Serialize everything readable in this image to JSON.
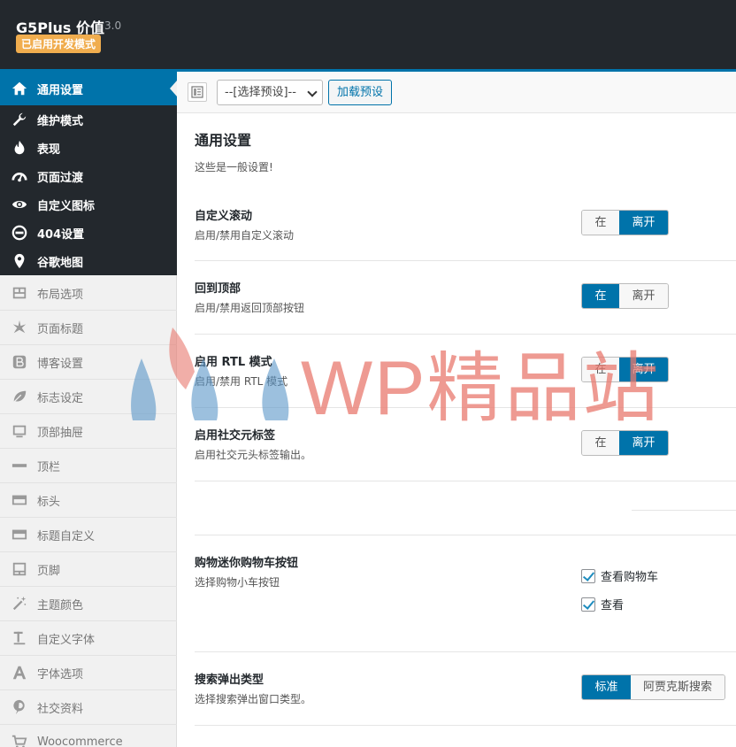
{
  "header": {
    "brand": "G5Plus 价值",
    "version": "3.0",
    "badge": "已启用开发模式"
  },
  "sidebar": {
    "active": {
      "label": "通用设置",
      "icon": "home-icon"
    },
    "dark_items": [
      {
        "label": "维护模式",
        "icon": "wrench-icon"
      },
      {
        "label": "表现",
        "icon": "fire-icon"
      },
      {
        "label": "页面过渡",
        "icon": "speedometer-icon"
      },
      {
        "label": "自定义图标",
        "icon": "eye-icon"
      },
      {
        "label": "404设置",
        "icon": "minus-circle-icon"
      },
      {
        "label": "谷歌地图",
        "icon": "map-pin-icon"
      }
    ],
    "light_items": [
      {
        "label": "布局选项",
        "icon": "layout-icon"
      },
      {
        "label": "页面标题",
        "icon": "star-icon"
      },
      {
        "label": "博客设置",
        "icon": "blog-b-icon"
      },
      {
        "label": "标志设定",
        "icon": "leaf-icon"
      },
      {
        "label": "顶部抽屉",
        "icon": "monitor-icon"
      },
      {
        "label": "顶栏",
        "icon": "dash-icon"
      },
      {
        "label": "标头",
        "icon": "header-icon"
      },
      {
        "label": "标题自定义",
        "icon": "header-custom-icon"
      },
      {
        "label": "页脚",
        "icon": "footer-icon"
      },
      {
        "label": "主题颜色",
        "icon": "magic-wand-icon"
      },
      {
        "label": "自定义字体",
        "icon": "text-t-icon"
      },
      {
        "label": "字体选项",
        "icon": "font-a-icon"
      },
      {
        "label": "社交资料",
        "icon": "pinterest-icon"
      },
      {
        "label": "Woocommerce",
        "icon": "cart-icon"
      }
    ]
  },
  "toolbar": {
    "preset_select": "--[选择预设]--",
    "load_button": "加载预设"
  },
  "main": {
    "title": "通用设置",
    "description": "这些是一般设置!",
    "on_label": "在",
    "off_label": "离开",
    "settings": [
      {
        "title": "自定义滚动",
        "subtitle": "启用/禁用自定义滚动",
        "value": "off"
      },
      {
        "title": "回到顶部",
        "subtitle": "启用/禁用返回顶部按钮",
        "value": "on"
      },
      {
        "title": "启用 RTL 模式",
        "subtitle": "启用/禁用 RTL 模式",
        "value": "off"
      },
      {
        "title": "启用社交元标签",
        "subtitle": "启用社交元头标签输出。",
        "value": "off"
      }
    ],
    "cart": {
      "title": "购物迷你购物车按钮",
      "subtitle": "选择购物小车按钮",
      "options": [
        {
          "label": "查看购物车",
          "checked": true
        },
        {
          "label": "查看",
          "checked": true
        }
      ]
    },
    "search": {
      "title": "搜索弹出类型",
      "subtitle": "选择搜索弹出窗口类型。",
      "options": [
        "标准",
        "阿贾克斯搜索"
      ],
      "selected": "标准"
    }
  },
  "watermark": "WP精品站",
  "colors": {
    "accent": "#0073aa",
    "dark": "#23282d",
    "badge": "#f0ad4e"
  }
}
